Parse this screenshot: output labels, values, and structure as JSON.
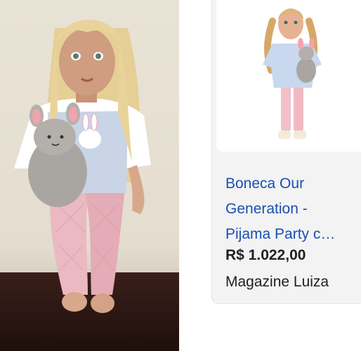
{
  "result_card": {
    "title_lines": [
      "Boneca Our",
      "Generation -",
      "Pijama Party c…"
    ],
    "price": "R$ 1.022,00",
    "store": "Magazine Luiza"
  },
  "colors": {
    "link": "#1a4fb0",
    "text": "#202124",
    "card_bg": "#f3f3f3",
    "wall": "#e6dfd1",
    "floor": "#2c1714",
    "leggings": "#e9b9c0",
    "shirt": "#c9d5e6"
  }
}
